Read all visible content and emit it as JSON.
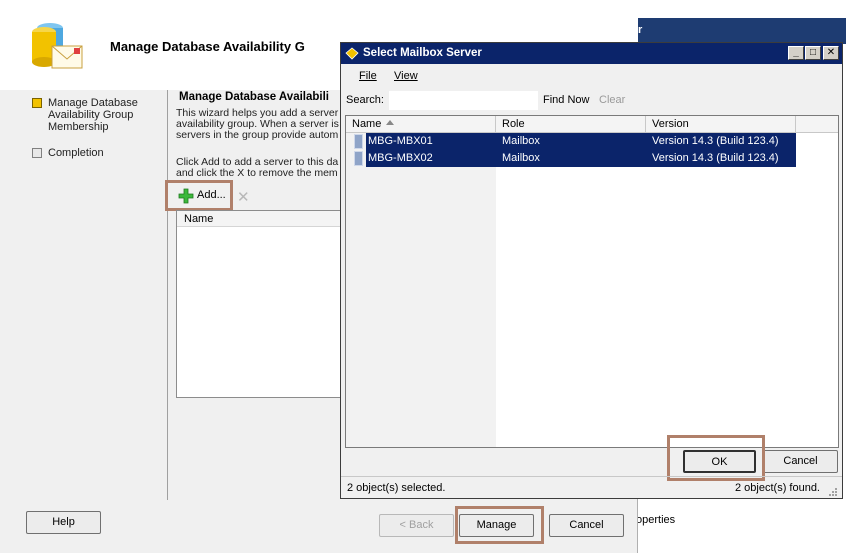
{
  "wizard": {
    "title": "Manage Database Availability G",
    "steps": [
      {
        "label": "Manage Database Availability Group Membership",
        "active": true
      },
      {
        "label": "Completion",
        "active": false
      }
    ],
    "content": {
      "heading": "Manage Database Availabili",
      "paragraph": "This wizard helps you add a server\navailability group. When a server is\nservers in the group provide autom",
      "paragraph2": "Click Add to add a server to this da\nand click the X to remove the mem",
      "add_label": "Add...",
      "list_header": "Name"
    },
    "buttons": {
      "help": "Help",
      "back": "< Back",
      "manage": "Manage",
      "cancel": "Cancel"
    }
  },
  "dialog": {
    "title": "Select Mailbox Server",
    "menu": {
      "file": "File",
      "view": "View"
    },
    "search_label": "Search:",
    "search_value": "",
    "find_now": "Find Now",
    "clear": "Clear",
    "columns": [
      "Name",
      "Role",
      "Version"
    ],
    "rows": [
      {
        "name": "MBG-MBX01",
        "role": "Mailbox",
        "version": "Version 14.3 (Build 123.4)"
      },
      {
        "name": "MBG-MBX02",
        "role": "Mailbox",
        "version": "Version 14.3 (Build 123.4)"
      }
    ],
    "ok": "OK",
    "cancel": "Cancel",
    "status_selected": "2 object(s) selected.",
    "status_found": "2 object(s) found."
  },
  "background": {
    "bar_text": "r",
    "properties_text": "operties"
  },
  "colors": {
    "selection": "#0b246a",
    "title_bar": "#0b246a",
    "highlight_box": "#b0806a"
  }
}
